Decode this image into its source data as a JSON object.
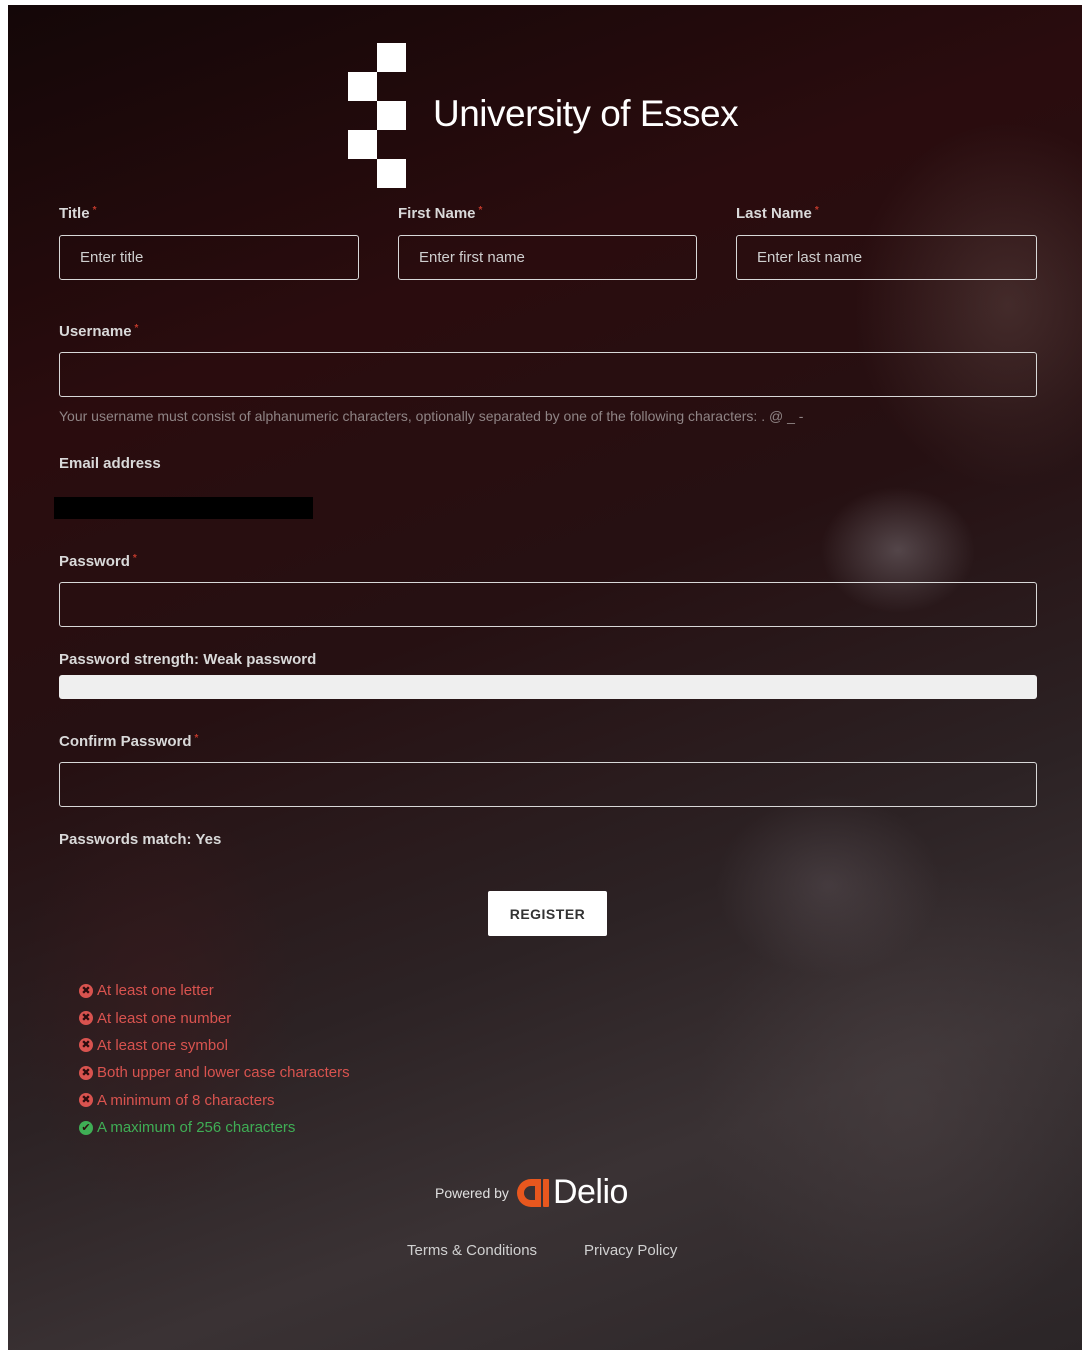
{
  "brand": {
    "name": "University of Essex"
  },
  "form": {
    "title": {
      "label": "Title",
      "placeholder": "Enter title",
      "required_mark": "*"
    },
    "first_name": {
      "label": "First Name",
      "placeholder": "Enter first name",
      "required_mark": "*"
    },
    "last_name": {
      "label": "Last Name",
      "placeholder": "Enter last name",
      "required_mark": "*"
    },
    "username": {
      "label": "Username",
      "required_mark": "*",
      "hint": "Your username must consist of alphanumeric characters, optionally separated by one of the following characters: . @ _ -"
    },
    "email": {
      "label": "Email address"
    },
    "password": {
      "label": "Password",
      "required_mark": "*"
    },
    "password_strength": {
      "text": "Password strength: Weak password",
      "level": 1.0
    },
    "confirm_password": {
      "label": "Confirm Password",
      "required_mark": "*"
    },
    "passwords_match": "Passwords match: Yes",
    "register_label": "REGISTER"
  },
  "rules": [
    {
      "text": "At least one letter",
      "status": "fail"
    },
    {
      "text": "At least one number",
      "status": "fail"
    },
    {
      "text": "At least one symbol",
      "status": "fail"
    },
    {
      "text": "Both upper and lower case characters",
      "status": "fail"
    },
    {
      "text": "A minimum of 8 characters",
      "status": "fail"
    },
    {
      "text": "A maximum of 256 characters",
      "status": "pass"
    }
  ],
  "footer": {
    "powered_by": "Powered by",
    "delio": "Delio",
    "terms": "Terms & Conditions",
    "privacy": "Privacy Policy"
  },
  "colors": {
    "fail": "#d9534f",
    "pass": "#3fae55",
    "delio_orange": "#e8571e",
    "required": "#c0392b"
  },
  "icons": {
    "fail": "times-circle-icon",
    "pass": "check-circle-icon",
    "delio": "delio-logo-icon"
  }
}
